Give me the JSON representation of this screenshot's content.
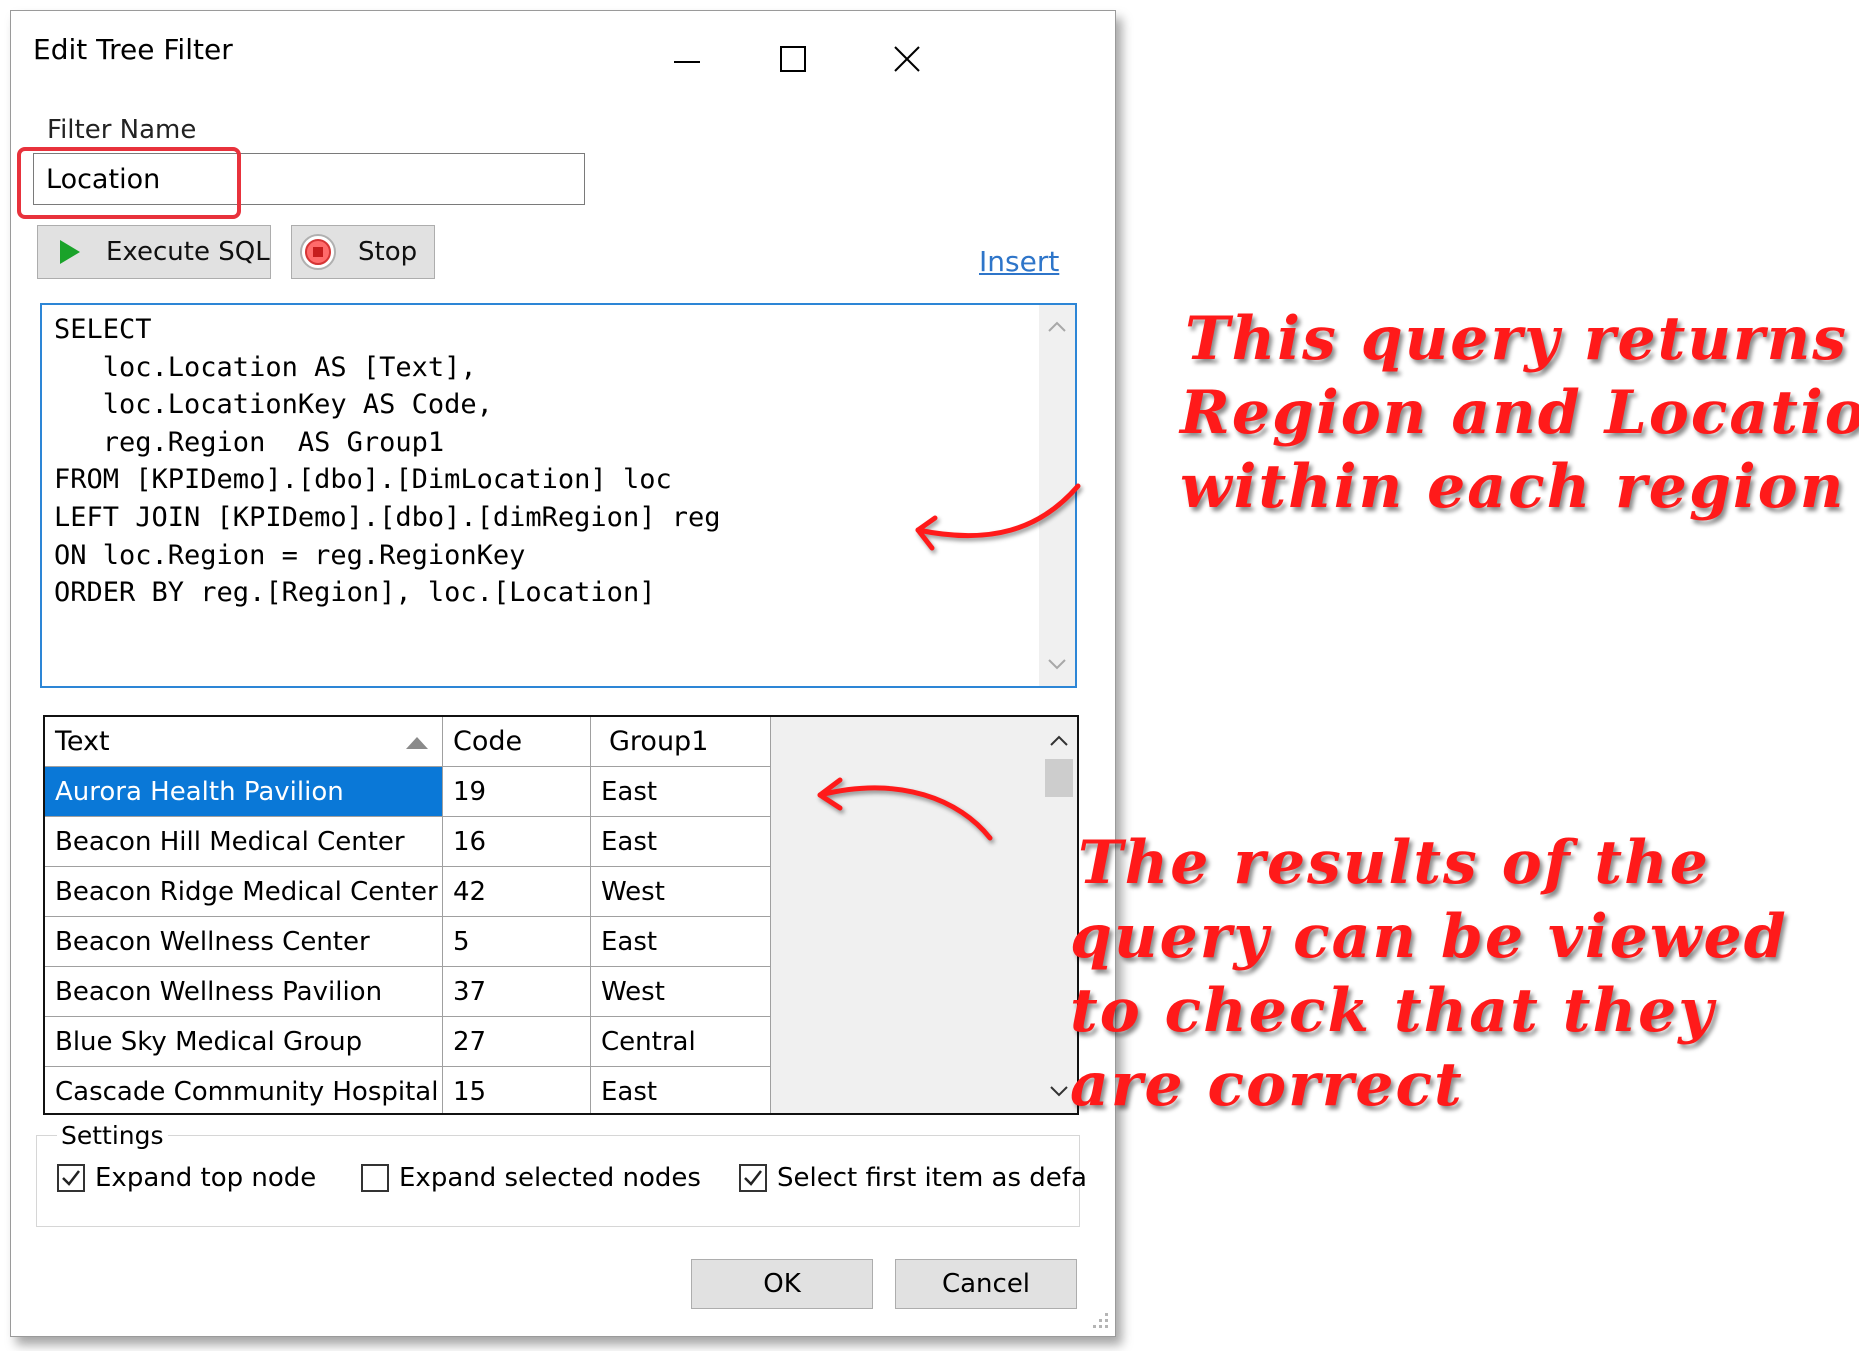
{
  "dialog": {
    "title": "Edit Tree Filter",
    "filter_name_label": "Filter Name",
    "filter_name_value": "Location",
    "execute_label": "Execute SQL",
    "stop_label": "Stop",
    "insert_label": "Insert",
    "sql_text": "SELECT\n   loc.Location AS [Text],\n   loc.LocationKey AS Code,\n   reg.Region  AS Group1\nFROM [KPIDemo].[dbo].[DimLocation] loc\nLEFT JOIN [KPIDemo].[dbo].[dimRegion] reg\nON loc.Region = reg.RegionKey\nORDER BY reg.[Region], loc.[Location]",
    "grid": {
      "headers": [
        "Text",
        "Code",
        "Group1"
      ],
      "rows": [
        [
          "Aurora Health Pavilion",
          "19",
          "East"
        ],
        [
          "Beacon Hill Medical Center",
          "16",
          "East"
        ],
        [
          "Beacon Ridge Medical Center",
          "42",
          "West"
        ],
        [
          "Beacon Wellness Center",
          "5",
          "East"
        ],
        [
          "Beacon Wellness Pavilion",
          "37",
          "West"
        ],
        [
          "Blue Sky Medical Group",
          "27",
          "Central"
        ],
        [
          "Cascade Community Hospital",
          "15",
          "East"
        ]
      ],
      "selected_row": 0
    },
    "settings": {
      "label": "Settings",
      "expand_top": {
        "label": "Expand top node",
        "checked": true
      },
      "expand_selected": {
        "label": "Expand selected nodes",
        "checked": false
      },
      "select_first": {
        "label": "Select first item as defa",
        "checked": true
      }
    },
    "ok_label": "OK",
    "cancel_label": "Cancel"
  },
  "annotations": {
    "query": [
      "This query returns",
      "Region and Locations",
      "within each region"
    ],
    "results": [
      "The results of the",
      "query can be viewed",
      "to check that they",
      "are correct"
    ],
    "color": "#ff1a1a"
  },
  "colors": {
    "accent": "#2d86d6",
    "selection": "#0a78d7",
    "highlight_box": "#e8323c",
    "link": "#2e75c9"
  }
}
